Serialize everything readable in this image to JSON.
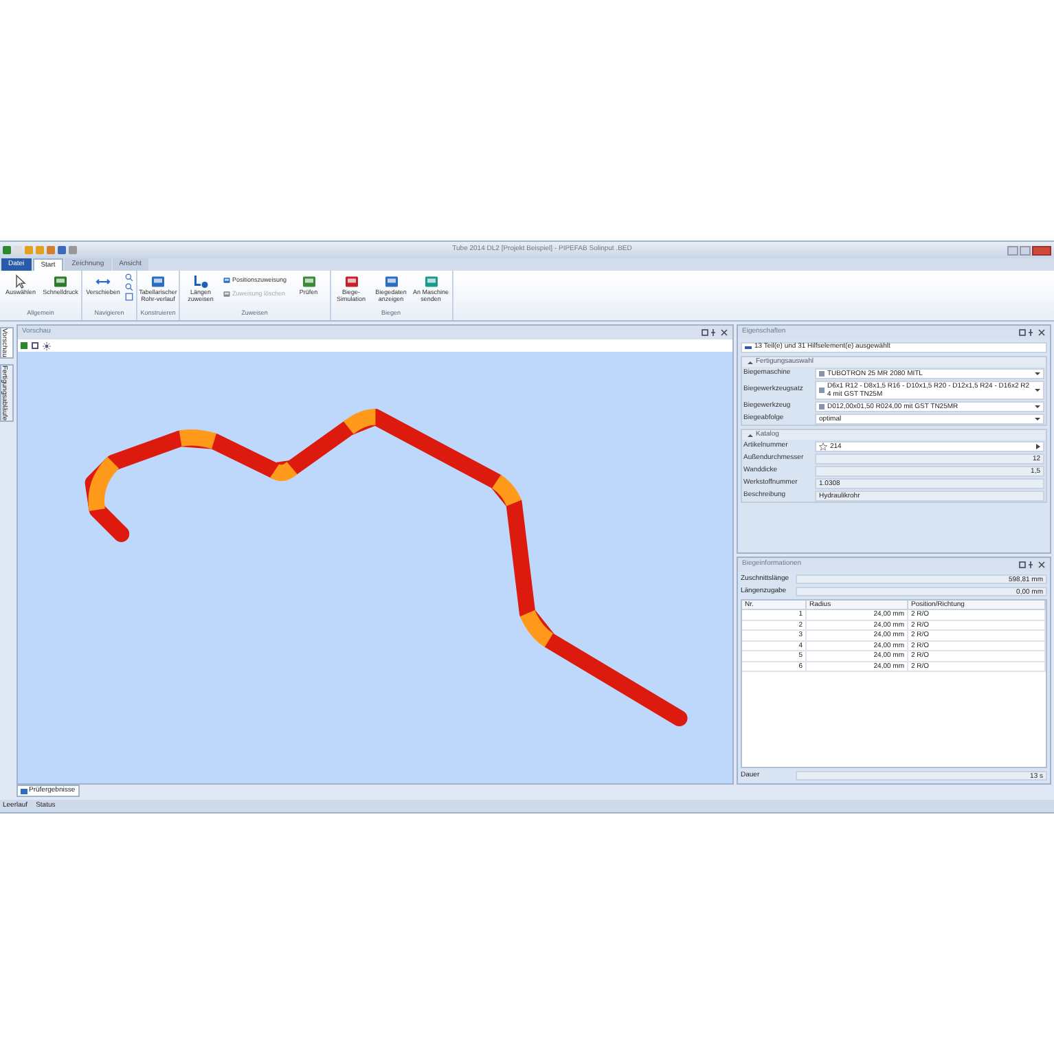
{
  "window": {
    "title": "Tube 2014 DL2 [Projekt Beispiel] - PIPEFAB Solinput .BED"
  },
  "ribbon_tabs": [
    {
      "label": "Datei",
      "selected": false,
      "kind": "file"
    },
    {
      "label": "Start",
      "selected": true,
      "kind": "tab"
    },
    {
      "label": "Zeichnung",
      "selected": false,
      "kind": "tab"
    },
    {
      "label": "Ansicht",
      "selected": false,
      "kind": "tab"
    }
  ],
  "ribbon_groups": [
    {
      "label": "Allgemein",
      "buttons": [
        {
          "label": "Auswählen",
          "kind": "large",
          "disabled": false
        },
        {
          "label": "Schnelldruck",
          "kind": "large",
          "disabled": false
        }
      ]
    },
    {
      "label": "Navigieren",
      "buttons": [
        {
          "label": "Verschieben",
          "kind": "large",
          "disabled": false
        }
      ]
    },
    {
      "label": "Konstruieren",
      "buttons": [
        {
          "label": "Tabellarischer Rohr-verlauf",
          "kind": "large",
          "disabled": false
        }
      ]
    },
    {
      "label": "Zuweisen",
      "buttons": [
        {
          "label": "Längen zuweisen",
          "kind": "large",
          "disabled": false
        },
        {
          "label": "Positionszuweisung",
          "kind": "small",
          "disabled": false
        },
        {
          "label": "Zuweisung löschen",
          "kind": "small",
          "disabled": true
        },
        {
          "label": "Prüfen",
          "kind": "large",
          "disabled": false
        }
      ]
    },
    {
      "label": "Biegen",
      "buttons": [
        {
          "label": "Biege-Simulation",
          "kind": "large",
          "disabled": false
        },
        {
          "label": "Biegedaten anzeigen",
          "kind": "large",
          "disabled": false
        },
        {
          "label": "An Maschine senden",
          "kind": "large",
          "disabled": false
        }
      ]
    }
  ],
  "side_tabs": [
    {
      "label": "Vorschau",
      "selected": true
    },
    {
      "label": "Fertigungsabläufe",
      "selected": false
    }
  ],
  "viewport": {
    "title": "Vorschau"
  },
  "properties": {
    "title": "Eigenschaften",
    "selection": "13 Teil(e) und 31 Hilfselement(e) ausgewählt",
    "sections": [
      {
        "title": "Fertigungsauswahl",
        "expanded": true,
        "rows": [
          {
            "label": "Biegemaschine",
            "value": "TUBOTRON 25 MR 2080 MITL",
            "kind": "combo"
          },
          {
            "label": "Biegewerkzeugsatz",
            "value": "D6x1 R12 - D8x1,5 R16 - D10x1,5 R20 - D12x1,5 R24 - D16x2 R24 mit GST TN25M",
            "kind": "combo"
          },
          {
            "label": "Biegewerkzeug",
            "value": "D012,00x01,50 R024,00 mit GST TN25MR",
            "kind": "combo"
          },
          {
            "label": "Biegeabfolge",
            "value": "optimal",
            "kind": "select"
          }
        ]
      },
      {
        "title": "Katalog",
        "expanded": true,
        "rows": [
          {
            "label": "Artikelnummer",
            "value": "214",
            "kind": "lookup"
          },
          {
            "label": "Außendurchmesser",
            "value": "12",
            "kind": "number"
          },
          {
            "label": "Wanddicke",
            "value": "1,5",
            "kind": "number"
          },
          {
            "label": "Werkstoffnummer",
            "value": "1.0308",
            "kind": "text"
          },
          {
            "label": "Beschreibung",
            "value": "Hydraulikrohr",
            "kind": "text"
          }
        ]
      }
    ]
  },
  "bend_info": {
    "title": "Biegeinformationen",
    "fields": [
      {
        "label": "Zuschnittslänge",
        "value": "598,81 mm"
      },
      {
        "label": "Längenzugabe",
        "value": "0,00 mm"
      }
    ],
    "table": {
      "columns": [
        "Nr.",
        "Radius",
        "Position/Richtung"
      ],
      "rows": [
        [
          "1",
          "24,00 mm",
          "2 R/O"
        ],
        [
          "2",
          "24,00 mm",
          "2 R/O"
        ],
        [
          "3",
          "24,00 mm",
          "2 R/O"
        ],
        [
          "4",
          "24,00 mm",
          "2 R/O"
        ],
        [
          "5",
          "24,00 mm",
          "2 R/O"
        ],
        [
          "6",
          "24,00 mm",
          "2 R/O"
        ]
      ]
    },
    "duration": {
      "label": "Dauer",
      "value": "13 s"
    }
  },
  "bottom_tabs": [
    {
      "label": "Prüfergebnisse",
      "selected": true
    }
  ],
  "status_bar": [
    "Leerlauf",
    "Status"
  ]
}
